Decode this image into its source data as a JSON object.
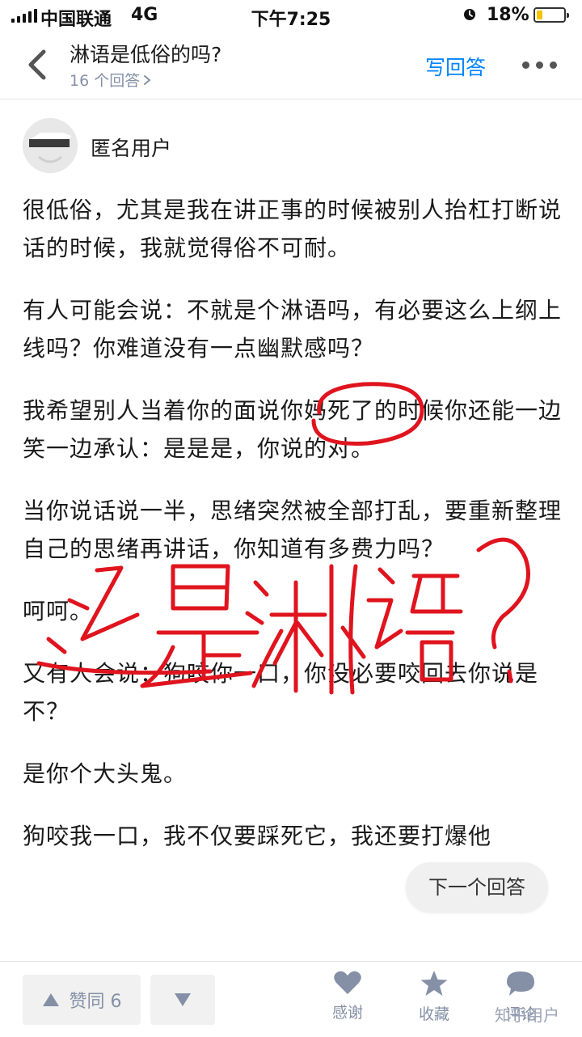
{
  "status_bar": {
    "carrier": "中国联通",
    "network": "4G",
    "time": "下午7:25",
    "battery": "18%"
  },
  "nav": {
    "title": "淋语是低俗的吗?",
    "answer_count": "16 个回答",
    "write_answer": "写回答"
  },
  "answer": {
    "author": "匿名用户",
    "paragraphs": [
      "很低俗，尤其是我在讲正事的时候被别人抬杠打断说话的时候，我就觉得俗不可耐。",
      "有人可能会说：不就是个淋语吗，有必要这么上纲上线吗？你难道没有一点幽默感吗？",
      "我希望别人当着你的面说你妈死了的时候你还能一边笑一边承认：是是是，你说的对。",
      "当你说话说一半，思绪突然被全部打乱，要重新整理自己的思绪再讲话，你知道有多费力吗？",
      "呵呵。",
      "又有人会说：狗咬你一口，你没必要咬回去你说是不？",
      "是你个大头鬼。",
      "狗咬我一口，我不仅要踩死它，我还要打爆他"
    ]
  },
  "next_answer": "下一个回答",
  "bottom_bar": {
    "upvote": "赞同 6",
    "thanks": "感谢",
    "collect": "收藏",
    "comment": "评论"
  },
  "watermark": "知乎用户",
  "colors": {
    "accent": "#0084ff",
    "muted": "#8590a6",
    "annotation": "#e0141e"
  }
}
